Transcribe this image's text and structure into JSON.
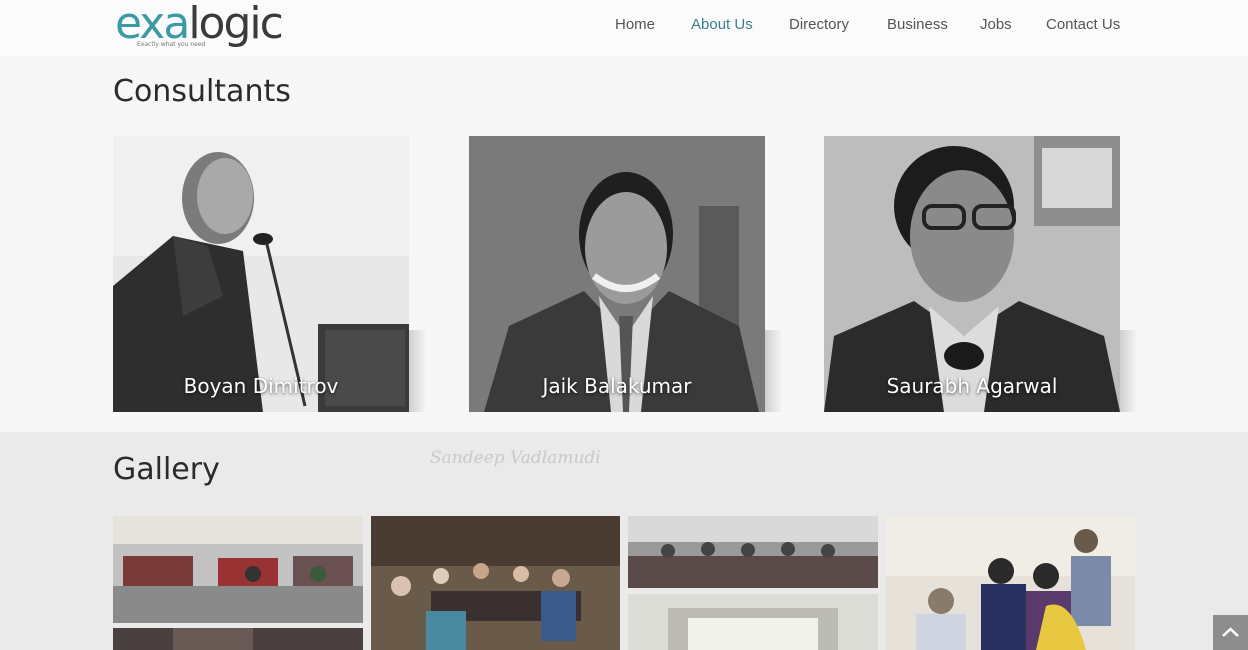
{
  "logo": {
    "prefix": "exa",
    "suffix": "logic",
    "tagline": "Exactly what you need"
  },
  "nav": {
    "items": [
      {
        "label": "Home"
      },
      {
        "label": "About Us",
        "active": true
      },
      {
        "label": "Directory"
      },
      {
        "label": "Business"
      },
      {
        "label": "Jobs"
      },
      {
        "label": "Contact Us"
      }
    ]
  },
  "consultants": {
    "title": "Consultants",
    "people": [
      {
        "name": "Boyan Dimitrov"
      },
      {
        "name": "Jaik Balakumar"
      },
      {
        "name": "Saurabh Agarwal"
      }
    ]
  },
  "gallery": {
    "title": "Gallery",
    "watermark": "Sandeep Vadlamudi"
  },
  "colors": {
    "accent": "#3a9aa6",
    "nav_active": "#3a7f8f",
    "text": "#2b2b2b"
  },
  "icons": {
    "scroll_top": "chevron-up-icon"
  }
}
